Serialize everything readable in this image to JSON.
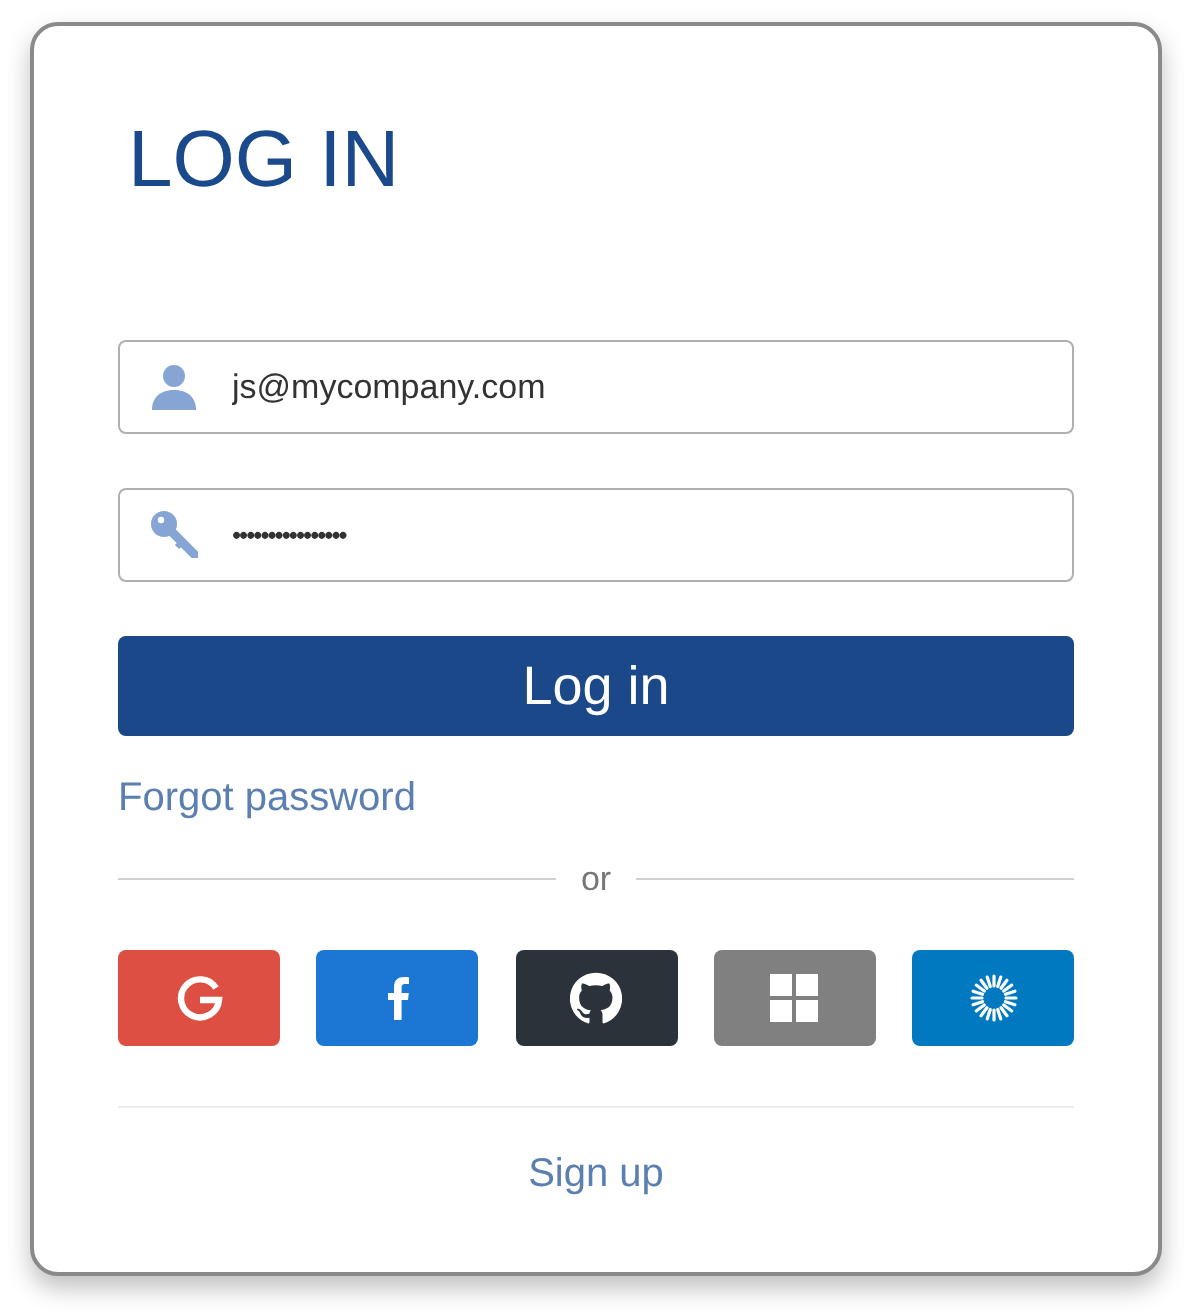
{
  "title": "LOG IN",
  "fields": [
    {
      "kind": "user",
      "value": "js@mycompany.com"
    },
    {
      "kind": "password",
      "value": "••••••••••••••••"
    }
  ],
  "submit": "Log in",
  "forgot_link": "Forgot password",
  "divider": "or",
  "social_buttons": [
    {
      "kind": "google",
      "color": "#dd4f43"
    },
    {
      "kind": "facebook",
      "color": "#1b77d3"
    },
    {
      "kind": "github",
      "color": "#2c323a"
    },
    {
      "kind": "windows",
      "color": "#808080"
    },
    {
      "kind": "sunburst",
      "color": "#0079c1"
    }
  ],
  "signup_link": "Sign up"
}
